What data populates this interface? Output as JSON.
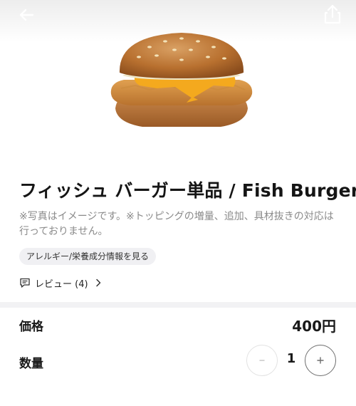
{
  "product": {
    "title": "フィッシュ バーガー単品 / Fish Burger",
    "image_name": "fish-burger",
    "description": "※写真はイメージです。※トッピングの増量、追加、具材抜きの対応は行っておりません。"
  },
  "links": {
    "allergy_label": "アレルギー/栄養成分情報を見る",
    "review_label": "レビュー (4)"
  },
  "price": {
    "label": "価格",
    "value": "400円"
  },
  "quantity": {
    "label": "数量",
    "value": "1"
  },
  "icons": {
    "back": "arrow-left-icon",
    "share": "share-icon",
    "review": "comment-icon",
    "chevron": "chevron-right-icon",
    "minus": "minus-icon",
    "plus": "plus-icon"
  },
  "colors": {
    "text_primary": "#1a1a1a",
    "text_muted": "#8a8a8a",
    "chip_bg": "#f0f0f3",
    "divider": "#f2f2f4"
  }
}
